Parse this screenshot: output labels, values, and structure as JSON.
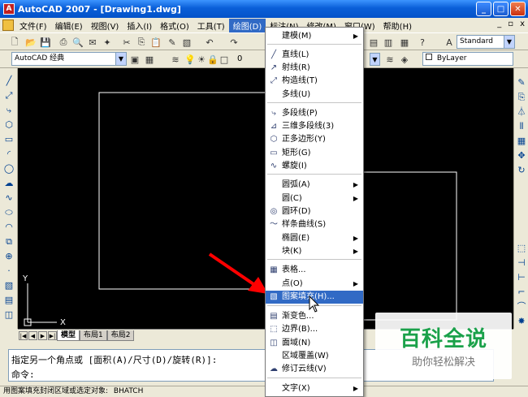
{
  "window": {
    "title": "AutoCAD 2007 - [Drawing1.dwg]",
    "minimize": "_",
    "maximize": "□",
    "close": "✕"
  },
  "menubar": {
    "items": [
      "文件(F)",
      "编辑(E)",
      "视图(V)",
      "插入(I)",
      "格式(O)",
      "工具(T)",
      "绘图(D)",
      "标注(N)",
      "修改(M)",
      "窗口(W)",
      "帮助(H)"
    ],
    "active_index": 6,
    "doc_controls": [
      "_",
      "▫",
      "x"
    ]
  },
  "toolbar1": {
    "textstyle": "Standard"
  },
  "toolbar2": {
    "workspace": "AutoCAD 经典",
    "layer": "0",
    "linetype": "ByLayer"
  },
  "draw_menu": {
    "items": [
      {
        "label": "建模(M)",
        "icon": "",
        "submenu": true
      },
      {
        "label": "直线(L)",
        "icon": "line-icon",
        "glyph": "╱"
      },
      {
        "label": "射线(R)",
        "icon": "ray-icon",
        "glyph": "↗"
      },
      {
        "label": "构造线(T)",
        "icon": "xline-icon",
        "glyph": "⤢"
      },
      {
        "label": "多线(U)",
        "icon": ""
      },
      {
        "label": "多段线(P)",
        "icon": "polyline-icon",
        "glyph": "⤷"
      },
      {
        "label": "三维多段线(3)",
        "icon": "3dpoly-icon",
        "glyph": "⊿"
      },
      {
        "label": "正多边形(Y)",
        "icon": "polygon-icon",
        "glyph": "⬡"
      },
      {
        "label": "矩形(G)",
        "icon": "rectangle-icon",
        "glyph": "▭"
      },
      {
        "label": "螺旋(I)",
        "icon": "helix-icon",
        "glyph": "∿"
      },
      {
        "label": "圆弧(A)",
        "icon": "",
        "submenu": true
      },
      {
        "label": "圆(C)",
        "icon": "",
        "submenu": true
      },
      {
        "label": "圆环(D)",
        "icon": "donut-icon",
        "glyph": "◎"
      },
      {
        "label": "样条曲线(S)",
        "icon": "spline-icon",
        "glyph": "〜"
      },
      {
        "label": "椭圆(E)",
        "icon": "",
        "submenu": true
      },
      {
        "label": "块(K)",
        "icon": "",
        "submenu": true
      },
      {
        "label": "表格...",
        "icon": "table-icon",
        "glyph": "▦"
      },
      {
        "label": "点(O)",
        "icon": "",
        "submenu": true
      },
      {
        "label": "图案填充(H)...",
        "icon": "hatch-icon",
        "glyph": "▧",
        "highlighted": true
      },
      {
        "label": "渐变色...",
        "icon": "gradient-icon",
        "glyph": "▤"
      },
      {
        "label": "边界(B)...",
        "icon": "boundary-icon",
        "glyph": "⬚"
      },
      {
        "label": "面域(N)",
        "icon": "region-icon",
        "glyph": "◫"
      },
      {
        "label": "区域覆盖(W)",
        "icon": ""
      },
      {
        "label": "修订云线(V)",
        "icon": "revcloud-icon",
        "glyph": "☁"
      },
      {
        "label": "文字(X)",
        "icon": "",
        "submenu": true
      }
    ]
  },
  "tabs": {
    "model": "模型",
    "layout1": "布局1",
    "layout2": "布局2"
  },
  "ucs": {
    "x": "X",
    "y": "Y"
  },
  "command": {
    "line1": "指定另一个角点或 [面积(A)/尺寸(D)/旋转(R)]:",
    "line2": "命令:"
  },
  "status": {
    "text": "用图案填充封闭区域或选定对象:",
    "command": "BHATCH"
  },
  "watermark": {
    "brand": "百科全说",
    "slogan": "助你轻松解决"
  },
  "colors": {
    "highlight": "#316ac5",
    "arrow": "#ff0000",
    "canvas": "#000000",
    "brand_green": "#1aa14a"
  }
}
